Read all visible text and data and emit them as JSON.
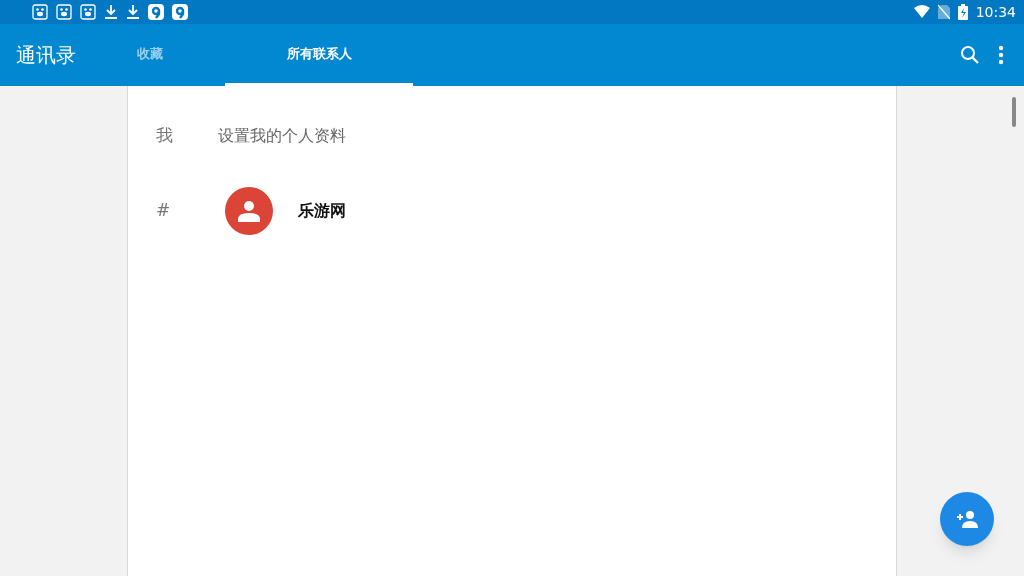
{
  "status_bar": {
    "time": "10:34"
  },
  "app_bar": {
    "title": "通讯录"
  },
  "tabs": [
    {
      "label": "收藏",
      "selected": false
    },
    {
      "label": "所有联系人",
      "selected": true
    }
  ],
  "rows": [
    {
      "kind": "profile",
      "section": "我",
      "label": "设置我的个人资料"
    },
    {
      "kind": "contact",
      "section": "#",
      "label": "乐游网",
      "color": "#db4437"
    }
  ]
}
